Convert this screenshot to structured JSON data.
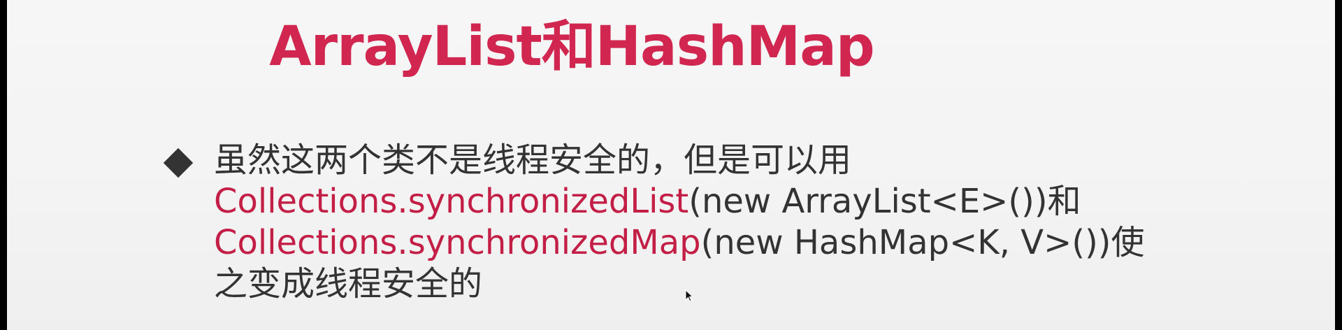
{
  "title": "ArrayList和HashMap",
  "bullet": {
    "line1": "虽然这两个类不是线程安全的，但是可以用",
    "line2_code": "Collections.synchronizedList",
    "line2_rest": "(new ArrayList<E>())和",
    "line3_code": "Collections.synchronizedMap",
    "line3_rest": "(new HashMap<K, V>())使",
    "line4": "之变成线程安全的"
  },
  "colors": {
    "accent": "#c31f46",
    "text": "#333333",
    "background": "#f3f3f3"
  },
  "icons": {
    "bullet": "diamond-bullet-icon",
    "cursor": "mouse-cursor-icon"
  }
}
